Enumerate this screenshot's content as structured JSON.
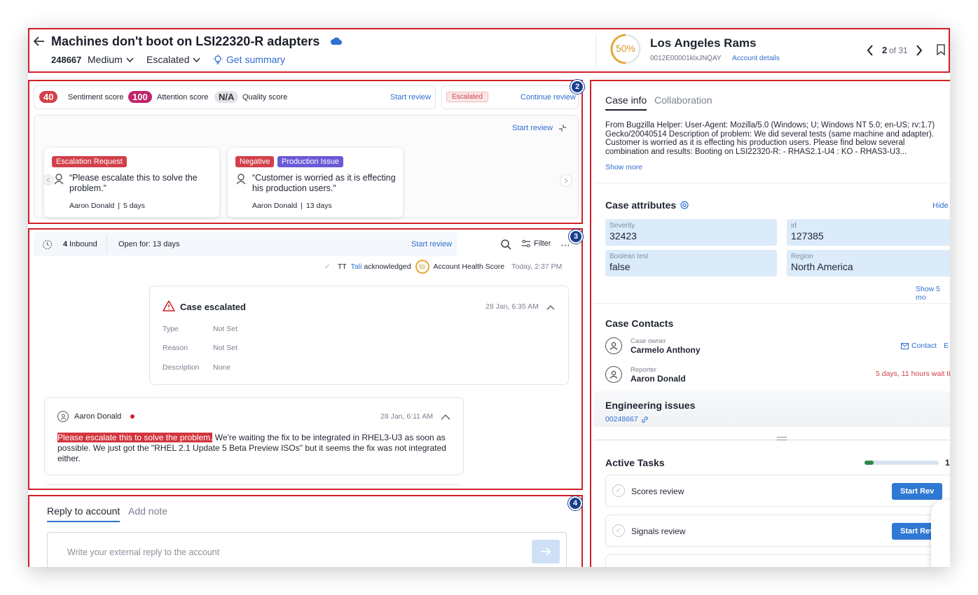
{
  "header": {
    "title": "Machines don't boot on LSI22320-R adapters",
    "case_number": "248667",
    "priority": "Medium",
    "status": "Escalated",
    "summary_link": "Get summary",
    "health_percent": "50%",
    "account_name": "Los Angeles Rams",
    "account_id": "0012E00001klxJNQAY",
    "account_details_link": "Account details",
    "pager_current": "2",
    "pager_total": "of 31"
  },
  "scores": {
    "sentiment_value": "40",
    "sentiment_label": "Sentiment score",
    "attention_value": "100",
    "attention_label": "Attention score",
    "quality_value": "N/A",
    "quality_label": "Quality score",
    "start_review": "Start review",
    "escalated_chip": "Escalated",
    "continue_review": "Continue review"
  },
  "signals": {
    "start_review": "Start review",
    "cards": [
      {
        "tags": [
          "Escalation Request"
        ],
        "quote": "“Please escalate this to solve the problem.”",
        "author": "Aaron Donald",
        "age": "5 days"
      },
      {
        "tags": [
          "Negative",
          "Production Issue"
        ],
        "quote": "“Customer is worried as it is effecting his production users.”",
        "author": "Aaron Donald",
        "age": "13 days"
      }
    ],
    "separator": "|"
  },
  "timeline": {
    "inbound_count": "4",
    "inbound_label": "Inbound",
    "open_for": "Open for: 13 days",
    "start_review": "Start review",
    "filter_label": "Filter",
    "ack_initials": "TT",
    "ack_user": "Tali",
    "ack_text": "acknowledged",
    "ack_score": "50",
    "ack_target": "Account Health Score",
    "ack_time": "Today, 2:37 PM",
    "escalation": {
      "title": "Case escalated",
      "time": "28 Jan, 6:35 AM",
      "rows": [
        {
          "label": "Type",
          "value": "Not Set"
        },
        {
          "label": "Reason",
          "value": "Not Set"
        },
        {
          "label": "Description",
          "value": "None"
        }
      ]
    },
    "message": {
      "author": "Aaron Donald",
      "time": "28 Jan, 6:11 AM",
      "highlight": "Please escalate this to solve the problem.",
      "body": " We're waiting the fix to be integrated in RHEL3-U3 as soon as possible. We just got the \"RHEL 2.1 Update 5 Beta Preview ISOs\" but it seems the fix was not integrated either."
    }
  },
  "reply": {
    "tab_reply": "Reply to account",
    "tab_note": "Add note",
    "placeholder": "Write your external reply to the account"
  },
  "right": {
    "tab_case_info": "Case info",
    "tab_collaboration": "Collaboration",
    "description": "From Bugzilla Helper: User-Agent: Mozilla/5.0 (Windows; U; Windows NT 5.0; en-US; rv:1.7) Gecko/20040514 Description of problem: We did several tests (same machine and adapter). Customer is worried as it is effecting his production users. Please find below several combination and results: Booting on LSI22320-R: - RHAS2.1-U4 : KO - RHAS3-U3...",
    "show_more": "Show more",
    "attributes_title": "Case attributes",
    "hide": "Hide",
    "attributes": [
      {
        "label": "Severity",
        "value": "32423"
      },
      {
        "label": "id",
        "value": "127385"
      },
      {
        "label": "Boolean test",
        "value": "false"
      },
      {
        "label": "Region",
        "value": "North America"
      }
    ],
    "show_more_attrs": "Show 5 mo",
    "contacts_title": "Case Contacts",
    "owner_label": "Case owner",
    "owner_name": "Carmelo Anthony",
    "contact_link": "Contact",
    "contact_extra": "E",
    "reporter_label": "Reporter",
    "reporter_name": "Aaron Donald",
    "reporter_wait": "5 days, 11 hours wait tir",
    "eng_title": "Engineering issues",
    "eng_id": "00248667",
    "tasks_title": "Active Tasks",
    "tasks_progress": 0.12,
    "tasks_count": "1,",
    "tasks": [
      {
        "name": "Scores review",
        "button": "Start Rev"
      },
      {
        "name": "Signals review",
        "button": "Start Rev"
      }
    ],
    "help_icon": "?"
  },
  "markers": {
    "m2": "2",
    "m3": "3",
    "m4": "4"
  },
  "colors": {
    "accent": "#2f6fd1",
    "danger": "#d0202a",
    "sentiment": "#d2404a",
    "attention": "#c0246a",
    "purple": "#6a5ad6",
    "health": "#e5a93a"
  }
}
